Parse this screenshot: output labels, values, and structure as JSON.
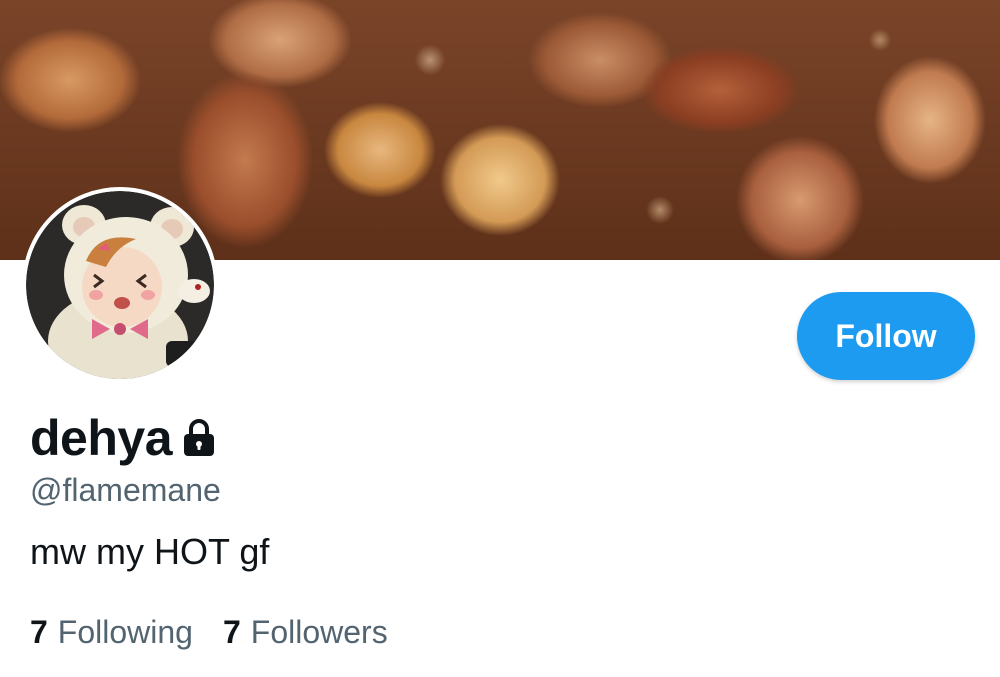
{
  "header": {
    "banner_alt": "candied nuts banner"
  },
  "profile": {
    "display_name": "dehya",
    "handle": "@flamemane",
    "bio": "mw my HOT gf",
    "protected_icon": "lock-icon"
  },
  "actions": {
    "follow_label": "Follow"
  },
  "stats": {
    "following_count": "7",
    "following_label": "Following",
    "followers_count": "7",
    "followers_label": "Followers"
  },
  "colors": {
    "accent": "#1d9bf0",
    "text_primary": "#0f1419",
    "text_secondary": "#536471"
  }
}
